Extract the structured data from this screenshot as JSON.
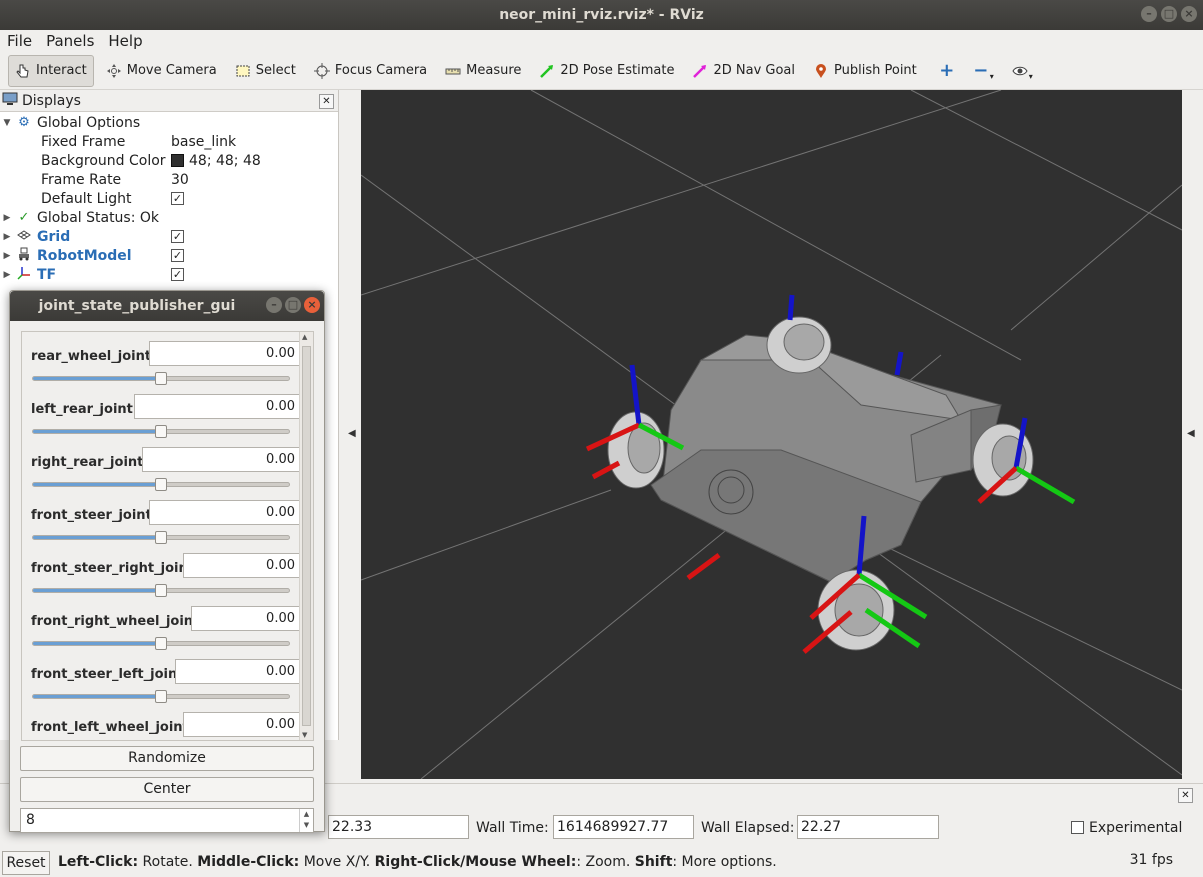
{
  "window": {
    "title": "neor_mini_rviz.rviz* - RViz"
  },
  "menu": {
    "file": "File",
    "panels": "Panels",
    "help": "Help"
  },
  "toolbar": {
    "tools": [
      {
        "label": "Interact",
        "icon": "cursor-icon",
        "active": true
      },
      {
        "label": "Move Camera",
        "icon": "move-camera-icon"
      },
      {
        "label": "Select",
        "icon": "select-icon"
      },
      {
        "label": "Focus Camera",
        "icon": "focus-camera-icon"
      },
      {
        "label": "Measure",
        "icon": "ruler-icon"
      },
      {
        "label": "2D Pose Estimate",
        "icon": "green-arrow-icon",
        "color": "#22c422"
      },
      {
        "label": "2D Nav Goal",
        "icon": "magenta-arrow-icon",
        "color": "#e022d8"
      },
      {
        "label": "Publish Point",
        "icon": "map-pin-icon",
        "color": "#c8501e"
      }
    ],
    "plus": "+",
    "minus": "−"
  },
  "displays": {
    "title": "Displays",
    "global_options": "Global Options",
    "fixed_frame_label": "Fixed Frame",
    "fixed_frame_value": "base_link",
    "background_color_label": "Background Color",
    "background_color_value": "48; 48; 48",
    "frame_rate_label": "Frame Rate",
    "frame_rate_value": "30",
    "default_light_label": "Default Light",
    "global_status": "Global Status: Ok",
    "grid": "Grid",
    "robot_model": "RobotModel",
    "tf": "TF"
  },
  "jsp": {
    "title": "joint_state_publisher_gui",
    "joints": [
      {
        "name": "rear_wheel_joint",
        "value": "0.00",
        "position": 0.5
      },
      {
        "name": "left_rear_joint",
        "value": "0.00",
        "position": 0.5
      },
      {
        "name": "right_rear_joint",
        "value": "0.00",
        "position": 0.5
      },
      {
        "name": "front_steer_joint",
        "value": "0.00",
        "position": 0.5
      },
      {
        "name": "front_steer_right_joint",
        "value": "0.00",
        "position": 0.5
      },
      {
        "name": "front_right_wheel_joint",
        "value": "0.00",
        "position": 0.5
      },
      {
        "name": "front_steer_left_joint",
        "value": "0.00",
        "position": 0.5
      },
      {
        "name": "front_left_wheel_joint",
        "value": "0.00",
        "position": 0.5
      }
    ],
    "randomize": "Randomize",
    "center": "Center",
    "spin_value": "8"
  },
  "time": {
    "ros_elapsed_value": "22.33",
    "wall_time_label": "Wall Time:",
    "wall_time_value": "1614689927.77",
    "wall_elapsed_label": "Wall Elapsed:",
    "wall_elapsed_value": "22.27",
    "experimental": "Experimental"
  },
  "status": {
    "reset": "Reset",
    "left_click": "Left-Click:",
    "left_click_desc": " Rotate. ",
    "middle_click": "Middle-Click:",
    "middle_click_desc": " Move X/Y. ",
    "right_click": "Right-Click/Mouse Wheel:",
    "right_click_desc": ": Zoom. ",
    "shift": "Shift",
    "shift_desc": ": More options.",
    "fps": "31 fps"
  },
  "colors": {
    "viewport_bg": "#303030",
    "axis_x": "#d81414",
    "axis_y": "#14c814",
    "axis_z": "#1414c8",
    "robot_body": "#8a8a8a"
  }
}
